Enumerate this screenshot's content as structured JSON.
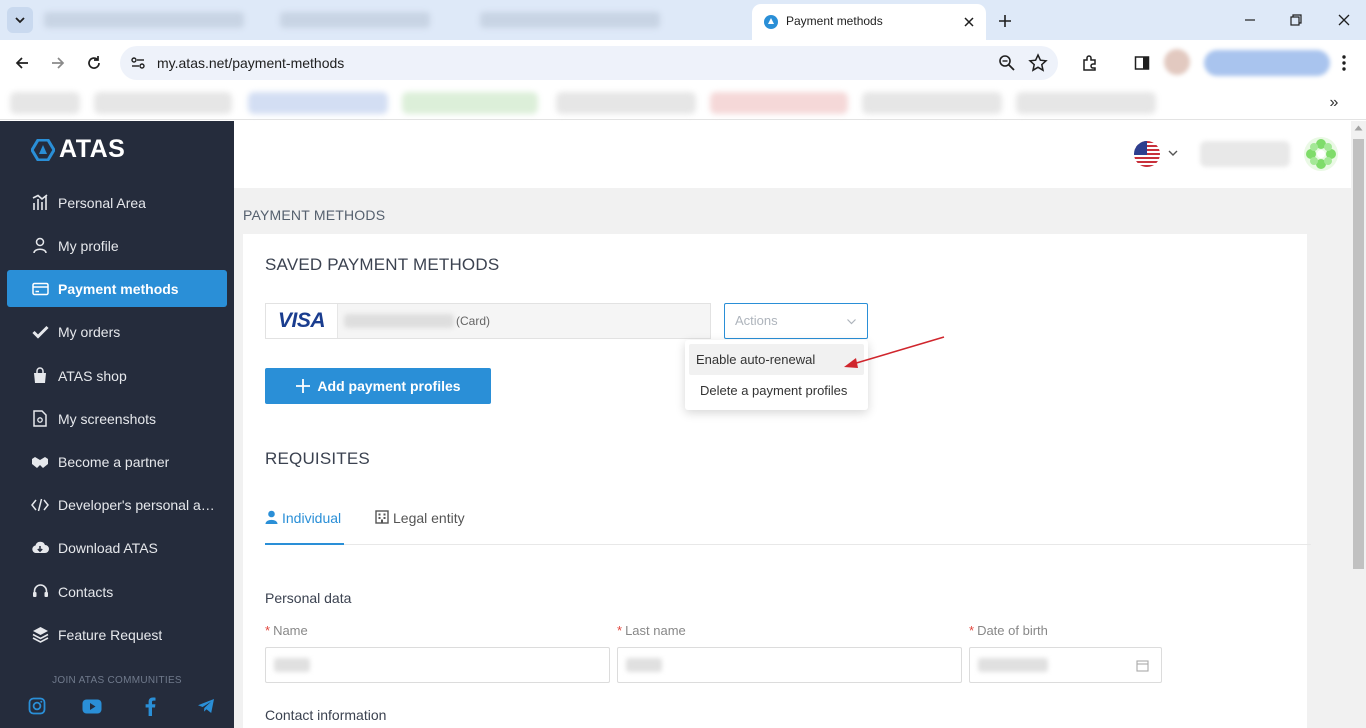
{
  "browser": {
    "active_tab_title": "Payment methods",
    "url": "my.atas.net/payment-methods"
  },
  "sidebar": {
    "logo_text": "ATAS",
    "items": [
      {
        "label": "Personal Area",
        "icon": "chart-bars-icon"
      },
      {
        "label": "My profile",
        "icon": "person-icon"
      },
      {
        "label": "Payment methods",
        "icon": "credit-card-icon"
      },
      {
        "label": "My orders",
        "icon": "check-icon"
      },
      {
        "label": "ATAS shop",
        "icon": "shopping-bag-icon"
      },
      {
        "label": "My screenshots",
        "icon": "screenshot-icon"
      },
      {
        "label": "Become a partner",
        "icon": "handshake-icon"
      },
      {
        "label": "Developer's personal acc...",
        "icon": "code-icon"
      },
      {
        "label": "Download ATAS",
        "icon": "cloud-download-icon"
      },
      {
        "label": "Contacts",
        "icon": "headset-icon"
      },
      {
        "label": "Feature Request",
        "icon": "layers-icon"
      }
    ],
    "communities_label": "JOIN ATAS COMMUNITIES",
    "social": [
      "instagram-icon",
      "youtube-icon",
      "facebook-icon",
      "telegram-icon"
    ]
  },
  "page": {
    "title": "PAYMENT METHODS",
    "saved_title": "SAVED PAYMENT METHODS",
    "card_brand": "VISA",
    "card_type": "(Card)",
    "actions_placeholder": "Actions",
    "actions_menu": [
      "Enable auto-renewal",
      "Delete a payment profiles"
    ],
    "add_button": "Add payment profiles",
    "requisites_title": "REQUISITES",
    "tabs": [
      "Individual",
      "Legal entity"
    ],
    "personal_data": "Personal data",
    "fields": [
      "Name",
      "Last name",
      "Date of birth"
    ],
    "required_mark": "*",
    "contact_info": "Contact information"
  },
  "colors": {
    "accent": "#2a8fd7",
    "sidebar_bg": "#252c3c",
    "annotation_arrow": "#d0262d"
  }
}
